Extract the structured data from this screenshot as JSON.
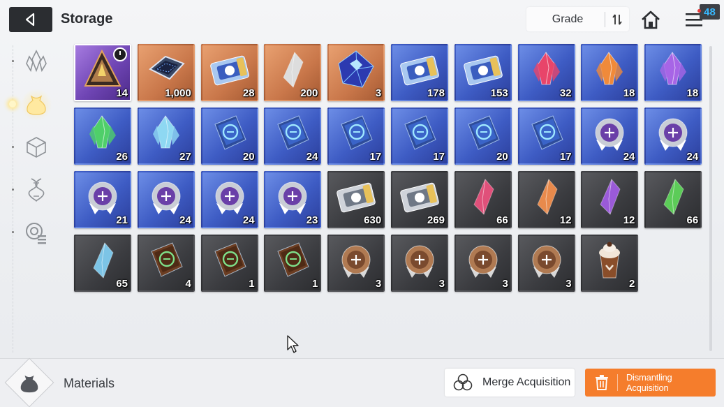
{
  "header": {
    "title": "Storage",
    "sort_label": "Grade",
    "notification_count": "48"
  },
  "sidebar": {
    "items": [
      {
        "name": "sidebar-item-crystals",
        "icon": "crystal-icon",
        "active": false
      },
      {
        "name": "sidebar-item-materials",
        "icon": "pouch-icon",
        "active": true
      },
      {
        "name": "sidebar-item-boxes",
        "icon": "cube-icon",
        "active": false
      },
      {
        "name": "sidebar-item-genes",
        "icon": "dna-icon",
        "active": false
      },
      {
        "name": "sidebar-item-records",
        "icon": "target-list-icon",
        "active": false
      }
    ]
  },
  "items": [
    {
      "icon": "triangle-device-icon",
      "bg": "purple",
      "qty": "14",
      "timer": true
    },
    {
      "icon": "chip-module-icon",
      "bg": "orange",
      "qty": "1,000"
    },
    {
      "icon": "gold-ticket-icon",
      "bg": "orange",
      "qty": "28"
    },
    {
      "icon": "gold-shards-icon",
      "bg": "orange",
      "qty": "200"
    },
    {
      "icon": "blue-cube-crystal-icon",
      "bg": "orange",
      "qty": "3"
    },
    {
      "icon": "portrait-ticket-icon",
      "bg": "blue",
      "qty": "178"
    },
    {
      "icon": "compass-ticket-icon",
      "bg": "blue",
      "qty": "153"
    },
    {
      "icon": "red-crystal-icon",
      "bg": "blue",
      "qty": "32",
      "color": "#e8456a"
    },
    {
      "icon": "fire-crystal-icon",
      "bg": "blue",
      "qty": "18",
      "color": "#f08a3a"
    },
    {
      "icon": "violet-crystal-icon",
      "bg": "blue",
      "qty": "18",
      "color": "#a765e6"
    },
    {
      "icon": "green-crystal-icon",
      "bg": "blue",
      "qty": "26",
      "color": "#4fcf6a"
    },
    {
      "icon": "ice-crystal-icon",
      "bg": "blue",
      "qty": "27",
      "color": "#8ed8f2"
    },
    {
      "icon": "swords-manual-icon",
      "bg": "blue",
      "qty": "20"
    },
    {
      "icon": "shield-manual-icon",
      "bg": "blue",
      "qty": "24"
    },
    {
      "icon": "eye-manual-icon",
      "bg": "blue",
      "qty": "17"
    },
    {
      "icon": "wing-manual-icon",
      "bg": "blue",
      "qty": "17"
    },
    {
      "icon": "bolt-manual-icon",
      "bg": "blue",
      "qty": "20"
    },
    {
      "icon": "globe-manual-icon",
      "bg": "blue",
      "qty": "17"
    },
    {
      "icon": "swords-badge-icon",
      "bg": "blue",
      "qty": "24"
    },
    {
      "icon": "shield-badge-icon",
      "bg": "blue",
      "qty": "24"
    },
    {
      "icon": "eye-badge-icon",
      "bg": "blue",
      "qty": "21"
    },
    {
      "icon": "wing-badge-icon",
      "bg": "blue",
      "qty": "24"
    },
    {
      "icon": "bolt-badge-icon",
      "bg": "blue",
      "qty": "24"
    },
    {
      "icon": "globe-badge-icon",
      "bg": "blue",
      "qty": "23"
    },
    {
      "icon": "silver-portrait-ticket-icon",
      "bg": "gray",
      "qty": "630"
    },
    {
      "icon": "silver-compass-ticket-icon",
      "bg": "gray",
      "qty": "269"
    },
    {
      "icon": "pink-shard-icon",
      "bg": "gray",
      "qty": "66",
      "color": "#e0507a"
    },
    {
      "icon": "amber-shard-icon",
      "bg": "gray",
      "qty": "12",
      "color": "#e88a4c"
    },
    {
      "icon": "purple-shard-icon",
      "bg": "gray",
      "qty": "12",
      "color": "#9a5ad8"
    },
    {
      "icon": "green-shard-icon",
      "bg": "gray",
      "qty": "66",
      "color": "#5ccc58"
    },
    {
      "icon": "blue-shard-icon",
      "bg": "gray",
      "qty": "65",
      "color": "#7cc4e6"
    },
    {
      "icon": "bronze-shield-manual-icon",
      "bg": "gray",
      "qty": "4"
    },
    {
      "icon": "bronze-eye-manual-icon",
      "bg": "gray",
      "qty": "1"
    },
    {
      "icon": "bronze-wing-manual-icon",
      "bg": "gray",
      "qty": "1"
    },
    {
      "icon": "bronze-swords-badge-icon",
      "bg": "gray",
      "qty": "3"
    },
    {
      "icon": "bronze-shield-badge-icon",
      "bg": "gray",
      "qty": "3"
    },
    {
      "icon": "bronze-wing-badge-icon",
      "bg": "gray",
      "qty": "3"
    },
    {
      "icon": "bronze-bolt-badge-icon",
      "bg": "gray",
      "qty": "3"
    },
    {
      "icon": "chocolate-drink-icon",
      "bg": "gray",
      "qty": "2"
    }
  ],
  "footer": {
    "category_label": "Materials",
    "merge_label": "Merge Acquisition",
    "dismantle_label": "Dismantling Acquisition"
  },
  "colors": {
    "accent_orange": "#f57d2c",
    "badge_blue": "#38b8ff",
    "header_dark": "#2b2d31"
  }
}
